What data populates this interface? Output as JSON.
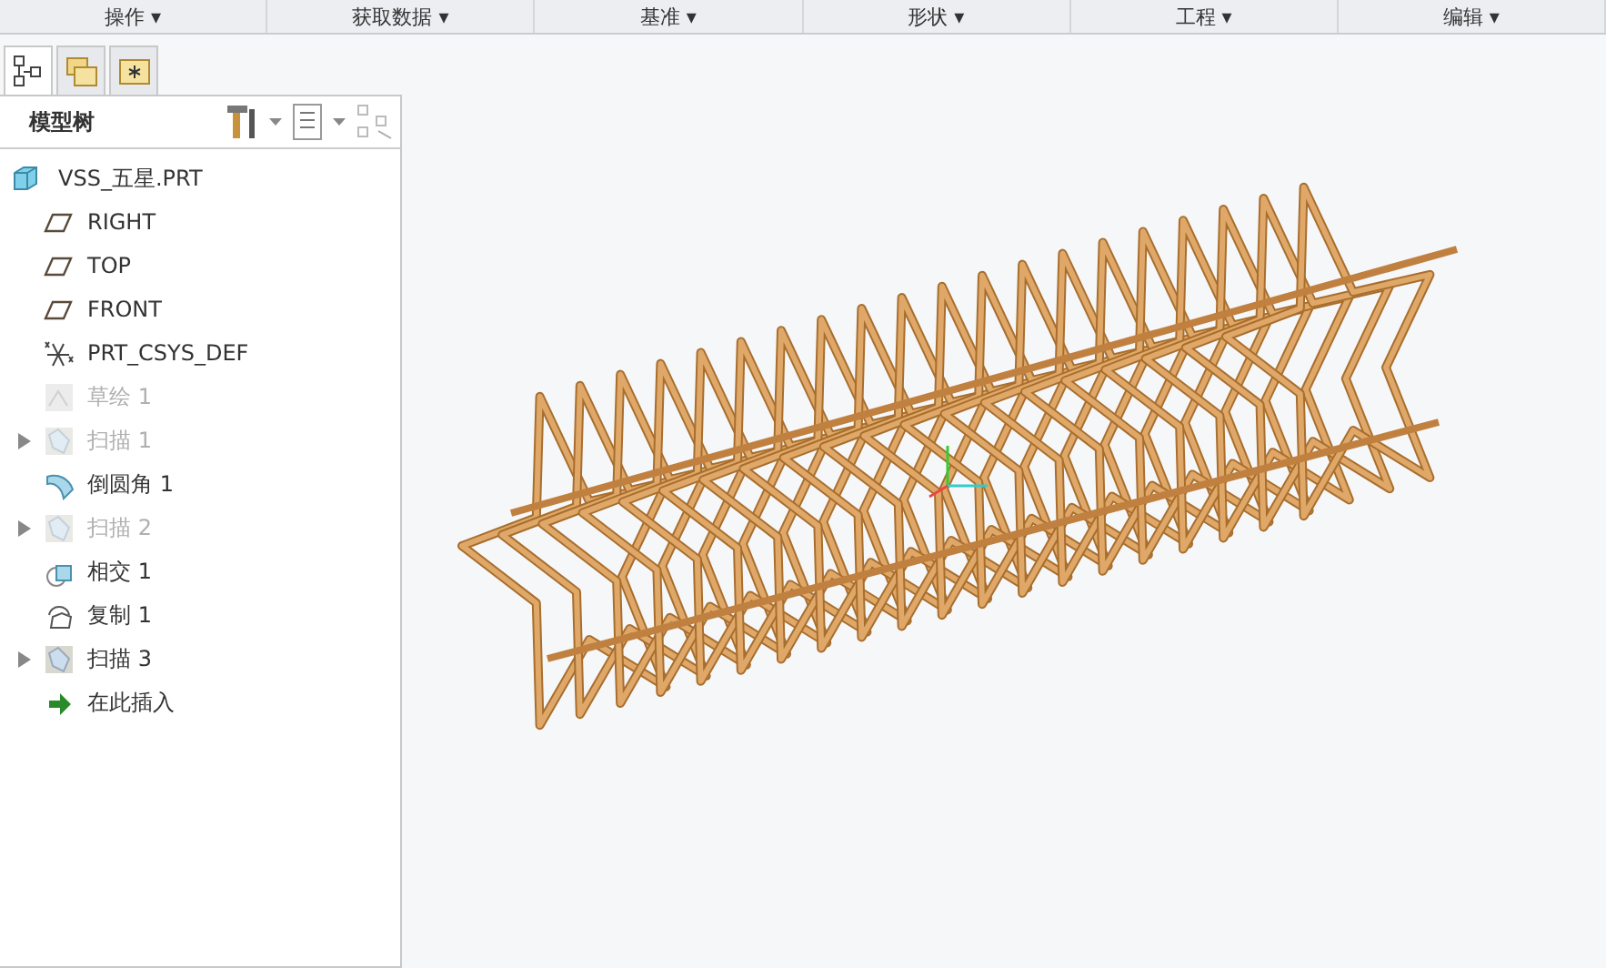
{
  "menu_bar": [
    {
      "label": "操作 ▾"
    },
    {
      "label": "获取数据 ▾"
    },
    {
      "label": "基准 ▾"
    },
    {
      "label": "形状 ▾"
    },
    {
      "label": "工程 ▾"
    },
    {
      "label": "编辑 ▾"
    }
  ],
  "panel_tabs": [
    {
      "kind": "tree",
      "selected": true
    },
    {
      "kind": "folders",
      "selected": false
    },
    {
      "kind": "favorites",
      "selected": false
    }
  ],
  "model_tree": {
    "title": "模型树",
    "items": [
      {
        "label": "VSS_五星.PRT",
        "kind": "part",
        "disabled": false,
        "expandable": false
      },
      {
        "label": "RIGHT",
        "kind": "plane",
        "disabled": false,
        "expandable": false
      },
      {
        "label": "TOP",
        "kind": "plane",
        "disabled": false,
        "expandable": false
      },
      {
        "label": "FRONT",
        "kind": "plane",
        "disabled": false,
        "expandable": false
      },
      {
        "label": "PRT_CSYS_DEF",
        "kind": "csys",
        "disabled": false,
        "expandable": false
      },
      {
        "label": "草绘 1",
        "kind": "sketch",
        "disabled": true,
        "expandable": false
      },
      {
        "label": "扫描 1",
        "kind": "sweep",
        "disabled": true,
        "expandable": true
      },
      {
        "label": "倒圆角 1",
        "kind": "round",
        "disabled": false,
        "expandable": false
      },
      {
        "label": "扫描 2",
        "kind": "sweep",
        "disabled": true,
        "expandable": true
      },
      {
        "label": "相交 1",
        "kind": "intersect",
        "disabled": false,
        "expandable": false
      },
      {
        "label": "复制 1",
        "kind": "copy",
        "disabled": false,
        "expandable": false
      },
      {
        "label": "扫描 3",
        "kind": "sweep",
        "disabled": false,
        "expandable": true
      },
      {
        "label": "在此插入",
        "kind": "insert",
        "disabled": false,
        "expandable": false
      }
    ]
  }
}
